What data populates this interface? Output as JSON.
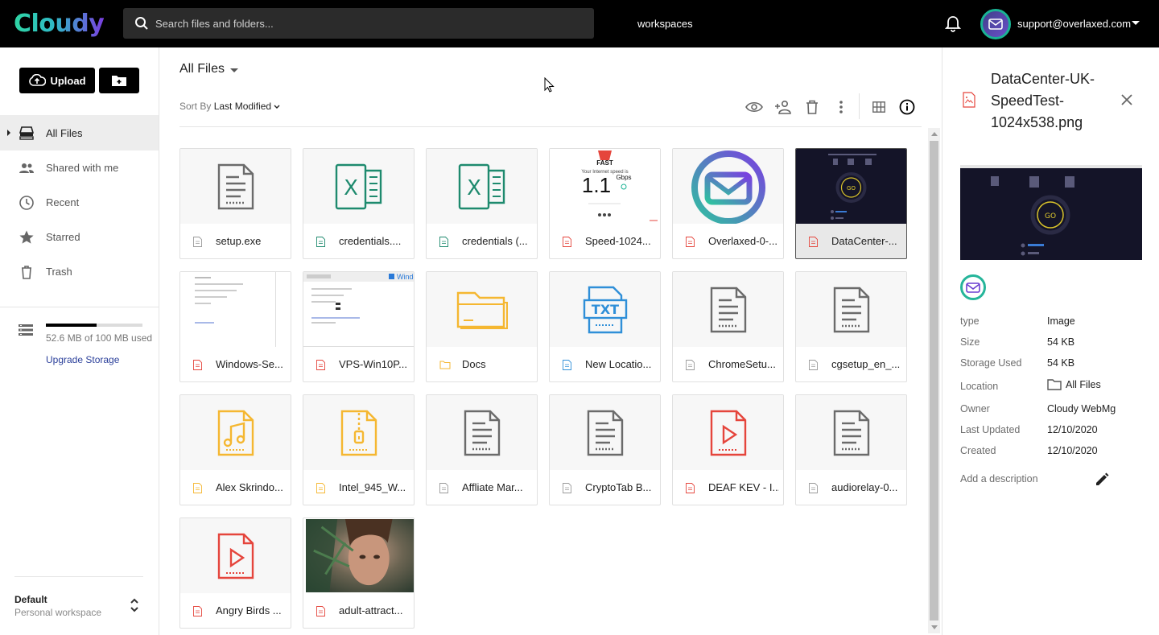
{
  "brand": {
    "logo_text": "Cloudy"
  },
  "search": {
    "placeholder": "Search files and folders..."
  },
  "header": {
    "workspaces_label": "workspaces",
    "user_email": "support@overlaxed.com"
  },
  "sidebar": {
    "upload_label": "Upload",
    "items": [
      {
        "label": "All Files",
        "icon": "storage-icon",
        "active": true
      },
      {
        "label": "Shared with me",
        "icon": "people-icon"
      },
      {
        "label": "Recent",
        "icon": "clock-icon"
      },
      {
        "label": "Starred",
        "icon": "star-icon"
      },
      {
        "label": "Trash",
        "icon": "trash-icon"
      }
    ],
    "storage": {
      "used_text": "52.6 MB of 100 MB used",
      "used_fraction": 0.526,
      "upgrade_label": "Upgrade Storage"
    },
    "workspace": {
      "name": "Default",
      "sub": "Personal workspace"
    }
  },
  "main": {
    "breadcrumb": "All Files",
    "sort_prefix": "Sort By",
    "sort_value": "Last Modified",
    "files": [
      {
        "name": "setup.exe",
        "kind": "doc"
      },
      {
        "name": "credentials....",
        "kind": "excel"
      },
      {
        "name": "credentials (...",
        "kind": "excel"
      },
      {
        "name": "Speed-1024...",
        "kind": "speedtest"
      },
      {
        "name": "Overlaxed-0-...",
        "kind": "overlaxed"
      },
      {
        "name": "DataCenter-...",
        "kind": "datacenter",
        "selected": true
      },
      {
        "name": "Windows-Se...",
        "kind": "screenshot"
      },
      {
        "name": "VPS-Win10P...",
        "kind": "screenshot2"
      },
      {
        "name": "Docs",
        "kind": "folder"
      },
      {
        "name": "New Locatio...",
        "kind": "txt"
      },
      {
        "name": "ChromeSetu...",
        "kind": "doc"
      },
      {
        "name": "cgsetup_en_...",
        "kind": "doc"
      },
      {
        "name": "Alex Skrindo...",
        "kind": "audio"
      },
      {
        "name": "Intel_945_W...",
        "kind": "zip"
      },
      {
        "name": "Affliate Mar...",
        "kind": "doc"
      },
      {
        "name": "CryptoTab B...",
        "kind": "doc"
      },
      {
        "name": "DEAF KEV - I...",
        "kind": "video"
      },
      {
        "name": "audiorelay-0...",
        "kind": "doc"
      },
      {
        "name": "Angry Birds ...",
        "kind": "video"
      },
      {
        "name": "adult-attract...",
        "kind": "photo"
      }
    ],
    "speedtest_thumb": {
      "brand": "FAST",
      "caption": "Your Internet speed is",
      "value": "1.1",
      "unit": "Gbps"
    },
    "screenshot_thumb_text": "Windo"
  },
  "panel": {
    "title": "DataCenter-UK-SpeedTest-1024x538.png",
    "preview_button": "GO",
    "details": [
      {
        "key": "type",
        "value": "Image"
      },
      {
        "key": "Size",
        "value": "54 KB"
      },
      {
        "key": "Storage Used",
        "value": "54 KB"
      },
      {
        "key": "Location",
        "value": "All Files"
      },
      {
        "key": "Owner",
        "value": "Cloudy WebMg"
      },
      {
        "key": "Last Updated",
        "value": "12/10/2020"
      },
      {
        "key": "Created",
        "value": "12/10/2020"
      }
    ],
    "add_description": "Add a description"
  },
  "colors": {
    "accent": "#2a3f9a",
    "excel": "#1e8a6e",
    "folder": "#f5b731",
    "txt": "#2f8fd8",
    "video": "#e5453c",
    "logo_start": "#2fd5a3",
    "logo_end": "#7a3fe0"
  }
}
